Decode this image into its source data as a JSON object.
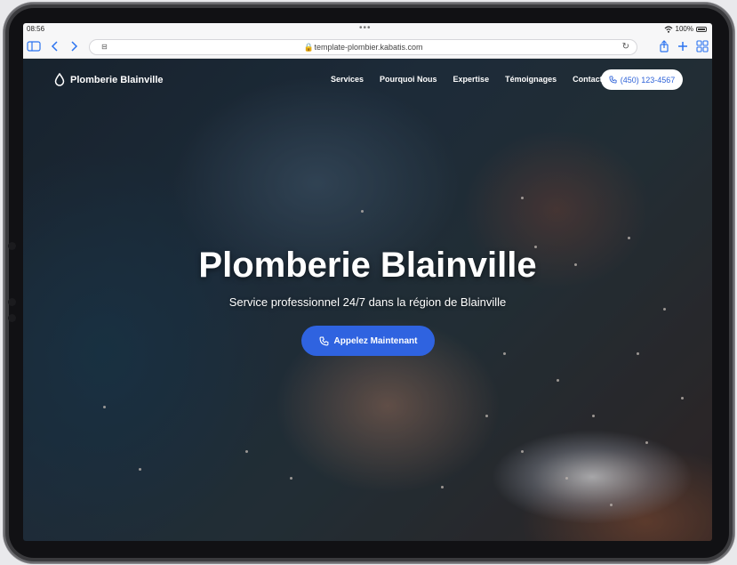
{
  "status_bar": {
    "time": "08:56",
    "battery": "100%"
  },
  "browser": {
    "url": "template-plombier.kabatis.com"
  },
  "nav": {
    "brand": "Plomberie Blainville",
    "links": [
      "Services",
      "Pourquoi Nous",
      "Expertise",
      "Témoignages",
      "Contact"
    ],
    "phone": "(450) 123-4567"
  },
  "hero": {
    "title": "Plomberie Blainville",
    "subtitle": "Service professionnel 24/7 dans la région de Blainville",
    "cta": "Appelez Maintenant"
  },
  "colors": {
    "accent": "#2f63e0",
    "toolbar_icon": "#2b73f0"
  }
}
